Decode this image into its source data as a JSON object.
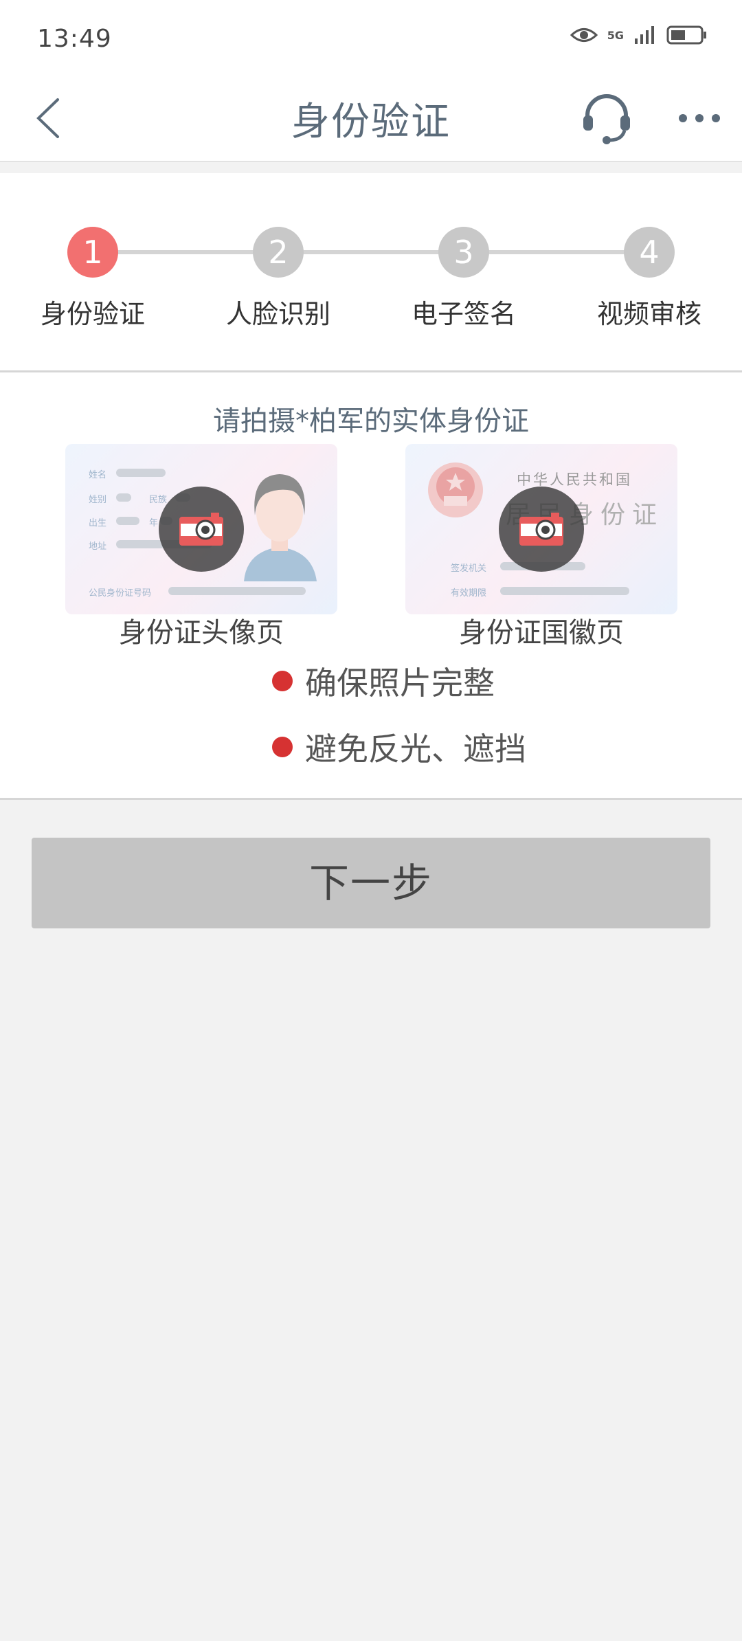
{
  "statusbar": {
    "time": "13:49",
    "network": "5G"
  },
  "header": {
    "title": "身份验证",
    "back_icon": "chevron-left-icon",
    "support_icon": "headset-icon",
    "more_icon": "more-dots-icon"
  },
  "steps": [
    {
      "number": "1",
      "label": "身份验证",
      "active": true
    },
    {
      "number": "2",
      "label": "人脸识别",
      "active": false
    },
    {
      "number": "3",
      "label": "电子签名",
      "active": false
    },
    {
      "number": "4",
      "label": "视频审核",
      "active": false
    }
  ],
  "capture": {
    "prompt": "请拍摄*柏军的实体身份证",
    "front": {
      "caption": "身份证头像页",
      "fields": [
        "姓名",
        "姓别",
        "民族",
        "出生",
        "年",
        "地址",
        "公民身份证号码"
      ]
    },
    "back": {
      "caption": "身份证国徽页",
      "heading_top": "中华人民共和国",
      "heading_main": "居民身份证",
      "fields": [
        "签发机关",
        "有效期限"
      ]
    }
  },
  "tips": [
    "确保照片完整",
    "避免反光、遮挡"
  ],
  "colors": {
    "active_step": "#f27070",
    "inactive_step": "#c8c8c8",
    "tip_dot": "#d63232",
    "button_disabled": "#c4c4c4"
  },
  "next_button": {
    "label": "下一步"
  }
}
